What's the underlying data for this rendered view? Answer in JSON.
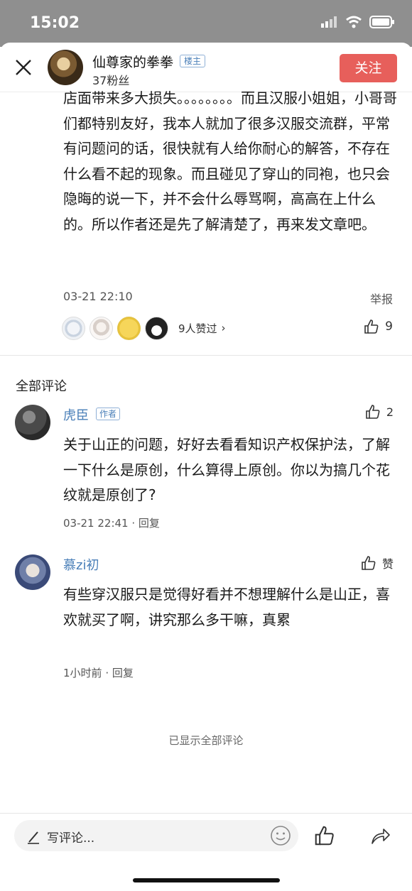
{
  "status_bar": {
    "time": "15:02"
  },
  "header": {
    "username": "仙尊家的拳拳",
    "badge": "楼主",
    "fans": "37粉丝",
    "follow_label": "关注"
  },
  "main_comment": {
    "text": "店面带来多大损失。。。。。。。。而且汉服小姐姐，小哥哥们都特别友好，我本人就加了很多汉服交流群，平常有问题问的话，很快就有人给你耐心的解答，不存在什么看不起的现象。而且碰见了穿山的同袍，也只会隐晦的说一下，并不会什么辱骂啊，高高在上什么的。所以作者还是先了解清楚了，再来发文章吧。",
    "timestamp": "03-21 22:10",
    "report_label": "举报",
    "likers_count": "9人赞过",
    "like_count": "9"
  },
  "section_title": "全部评论",
  "comments": [
    {
      "name": "虎臣",
      "badge": "作者",
      "like": "2",
      "text": "关于山正的问题，好好去看看知识产权保护法，了解一下什么是原创，什么算得上原创。你以为搞几个花纹就是原创了?",
      "time": "03-21 22:41",
      "reply": "回复"
    },
    {
      "name": "慕zi初",
      "like": "赞",
      "text": "有些穿汉服只是觉得好看并不想理解什么是山正，喜欢就买了啊，讲究那么多干嘛，真累",
      "time": "1小时前",
      "reply": "回复"
    }
  ],
  "all_shown": "已显示全部评论",
  "bottom_bar": {
    "placeholder": "写评论..."
  }
}
